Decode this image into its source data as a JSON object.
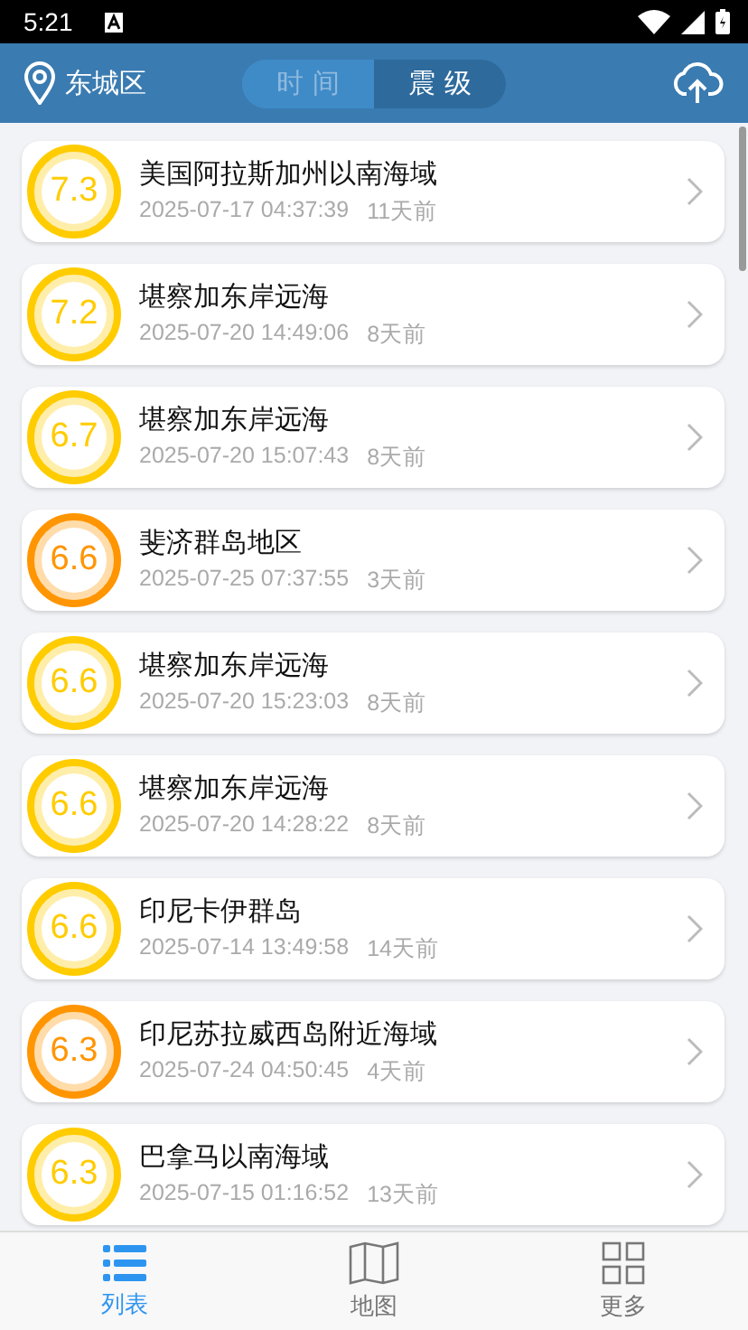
{
  "status_bar": {
    "time": "5:21"
  },
  "header": {
    "location": "东城区",
    "tabs": [
      {
        "label": "时 间",
        "selected": false
      },
      {
        "label": "震 级",
        "selected": true
      }
    ]
  },
  "quakes": [
    {
      "magnitude": "7.3",
      "place": "美国阿拉斯加州以南海域",
      "time": "2025-07-17 04:37:39",
      "ago": "11天前",
      "color": "#ffcc00"
    },
    {
      "magnitude": "7.2",
      "place": "堪察加东岸远海",
      "time": "2025-07-20 14:49:06",
      "ago": "8天前",
      "color": "#ffcc00"
    },
    {
      "magnitude": "6.7",
      "place": "堪察加东岸远海",
      "time": "2025-07-20 15:07:43",
      "ago": "8天前",
      "color": "#ffcc00"
    },
    {
      "magnitude": "6.6",
      "place": "斐济群岛地区",
      "time": "2025-07-25 07:37:55",
      "ago": "3天前",
      "color": "#ff9500"
    },
    {
      "magnitude": "6.6",
      "place": "堪察加东岸远海",
      "time": "2025-07-20 15:23:03",
      "ago": "8天前",
      "color": "#ffcc00"
    },
    {
      "magnitude": "6.6",
      "place": "堪察加东岸远海",
      "time": "2025-07-20 14:28:22",
      "ago": "8天前",
      "color": "#ffcc00"
    },
    {
      "magnitude": "6.6",
      "place": "印尼卡伊群岛",
      "time": "2025-07-14 13:49:58",
      "ago": "14天前",
      "color": "#ffcc00"
    },
    {
      "magnitude": "6.3",
      "place": "印尼苏拉威西岛附近海域",
      "time": "2025-07-24 04:50:45",
      "ago": "4天前",
      "color": "#ff9500"
    },
    {
      "magnitude": "6.3",
      "place": "巴拿马以南海域",
      "time": "2025-07-15 01:16:52",
      "ago": "13天前",
      "color": "#ffcc00"
    }
  ],
  "nav": [
    {
      "kind": "list",
      "label": "列表",
      "selected": true
    },
    {
      "kind": "map",
      "label": "地图",
      "selected": false
    },
    {
      "kind": "more",
      "label": "更多",
      "selected": false
    }
  ]
}
